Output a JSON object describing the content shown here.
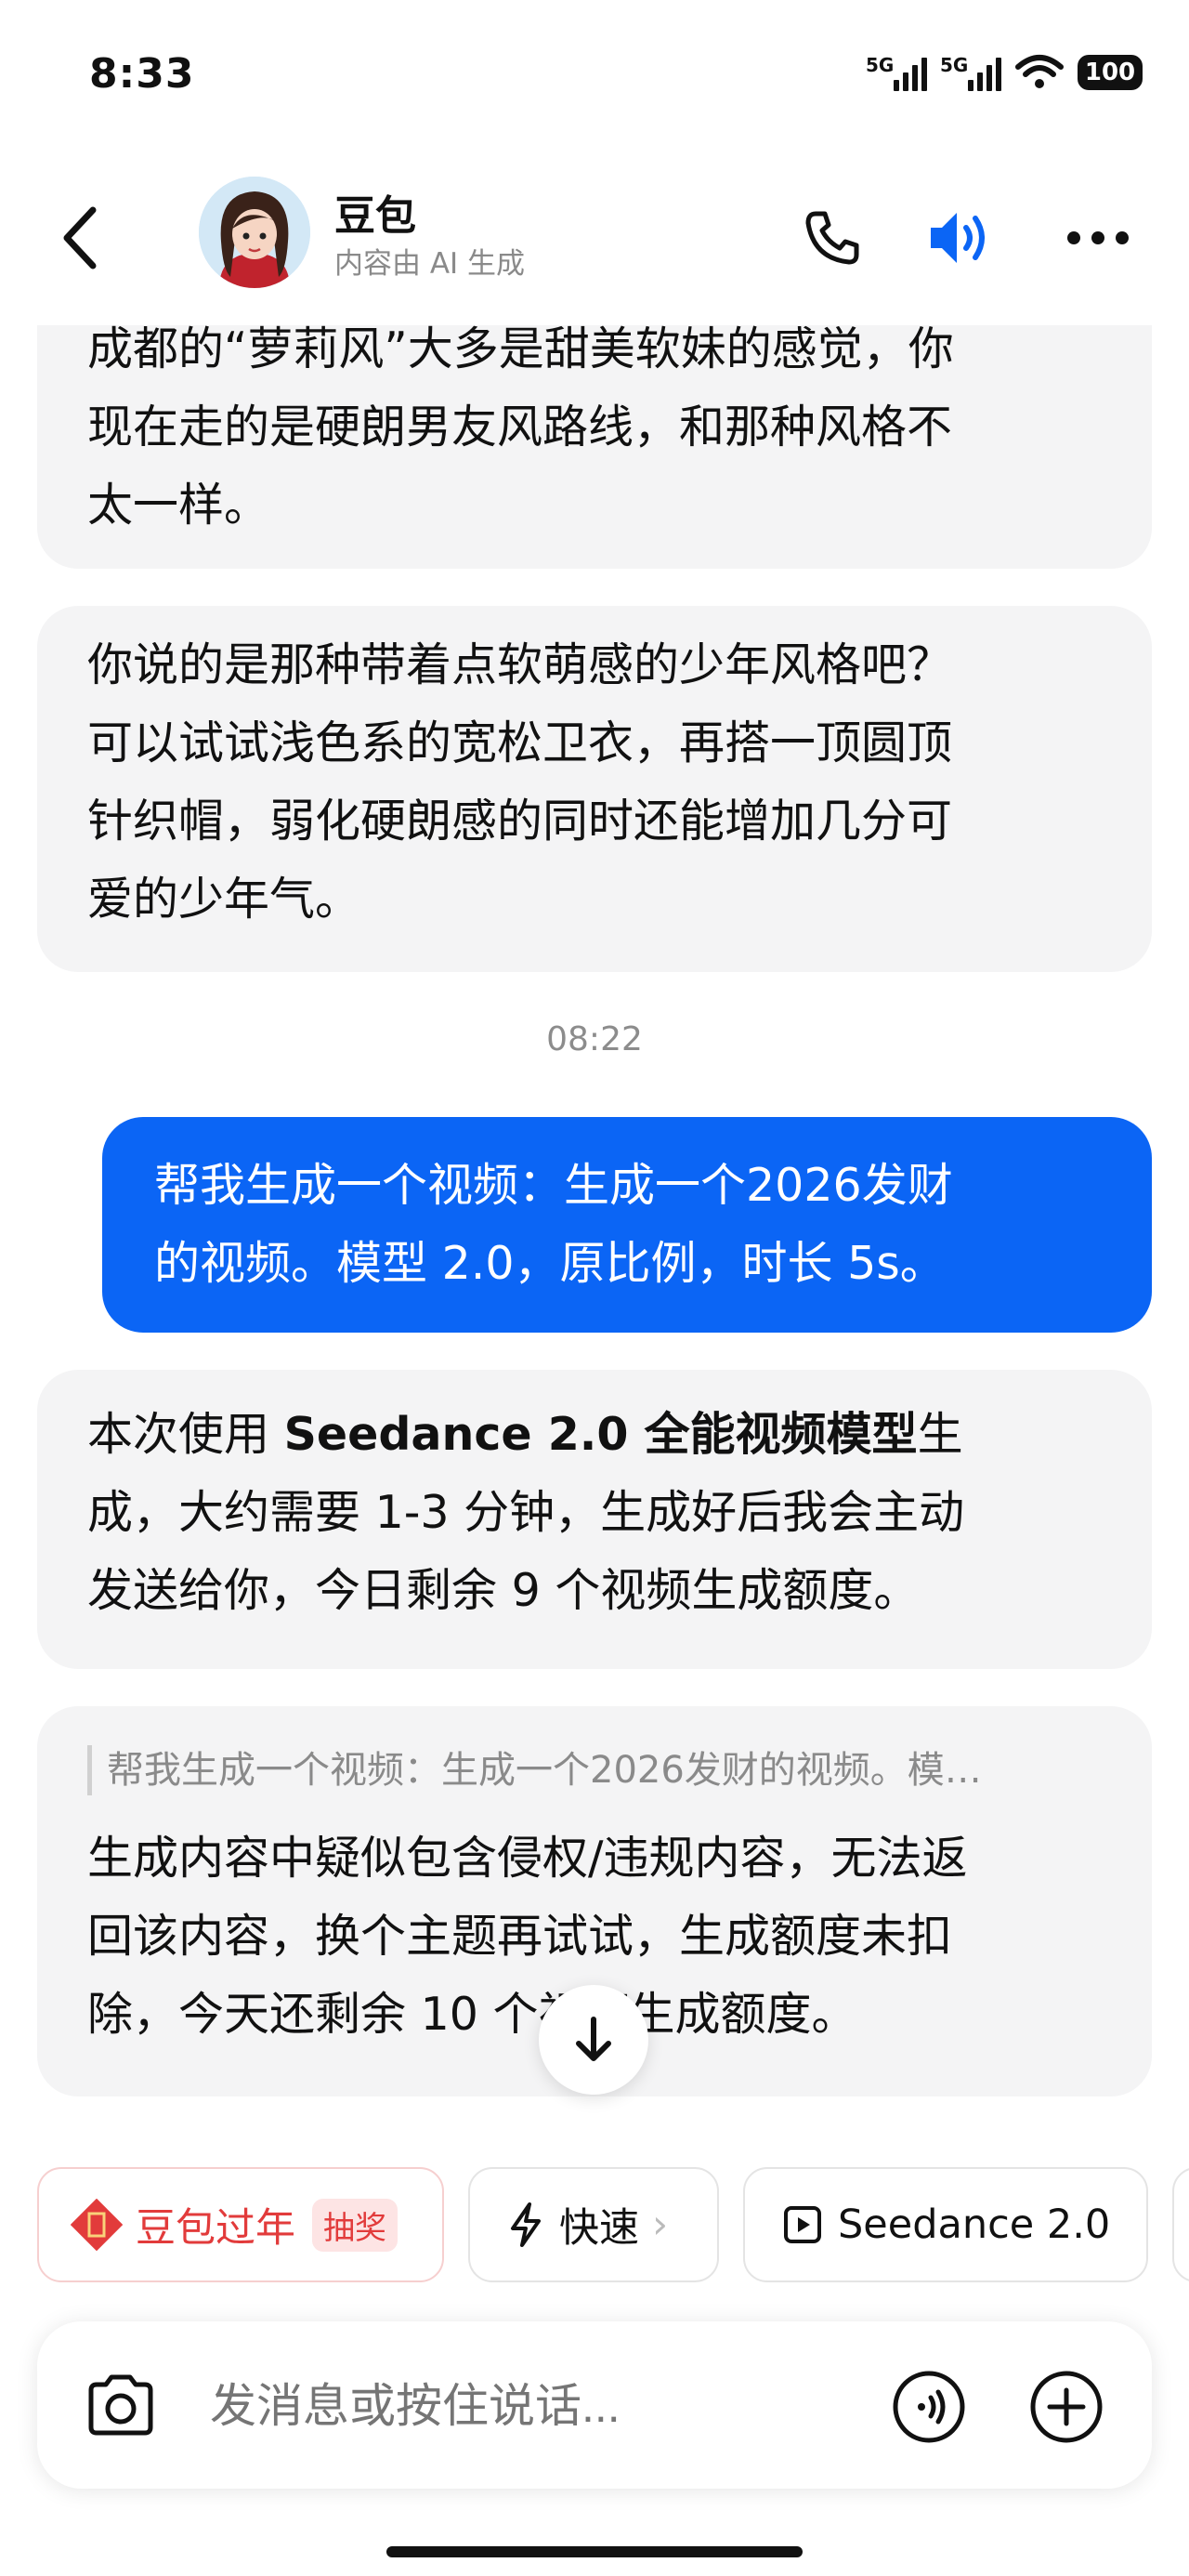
{
  "status_bar": {
    "time": "8:33",
    "signal1": "5G",
    "signal2": "5G",
    "battery": "100"
  },
  "header": {
    "bot_name": "豆包",
    "subtitle": "内容由 AI 生成",
    "icons": [
      "back-icon",
      "phone-icon",
      "speaker-icon",
      "more-icon"
    ],
    "accent": "#0b65f5"
  },
  "messages": {
    "ai_1": "成都的“萝莉风”大多是甜美软妹的感觉，你\n现在走的是硬朗男友风路线，和那种风格不\n太一样。",
    "ai_2": "你说的是那种带着点软萌感的少年风格吧？\n可以试试浅色系的宽松卫衣，再搭一顶圆顶\n针织帽，弱化硬朗感的同时还能增加几分可\n爱的少年气。",
    "timestamp": "08:22",
    "user_1": "帮我生成一个视频：生成一个2026发财\n的视频。模型 2.0，原比例，时长 5s。",
    "ai_3_prefix": "本次使用 ",
    "ai_3_bold": "Seedance 2.0 全能视频模型",
    "ai_3_suffix": "生\n成，大约需要 1-3 分钟，生成好后我会主动\n发送给你，今日剩余 9 个视频生成额度。",
    "quote": "帮我生成一个视频：生成一个2026发财的视频。模…",
    "ai_4": "生成内容中疑似包含侵权/违规内容，无法返\n回该内容，换个主题再试试，生成额度未扣\n除，今天还剩余 10 个视频生成额度。"
  },
  "chips": {
    "festival": "豆包过年",
    "festival_badge": "抽奖",
    "fast": "快速",
    "model": "Seedance 2.0"
  },
  "input": {
    "placeholder": "发消息或按住说话..."
  }
}
